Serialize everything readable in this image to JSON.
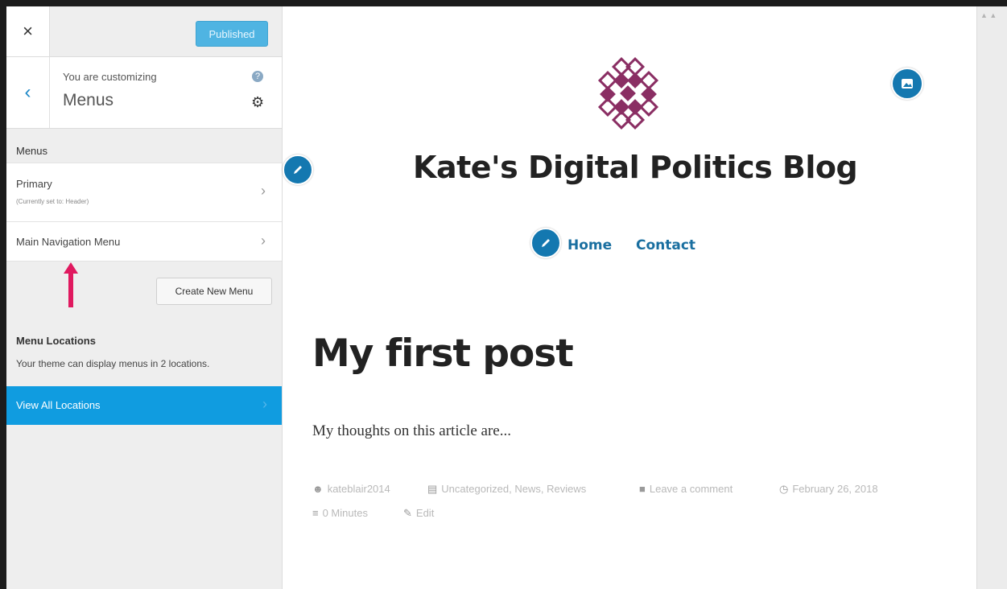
{
  "sidebar": {
    "close_glyph": "×",
    "publish_label": "Published",
    "customizing_label": "You are customizing",
    "panel_title": "Menus",
    "help_glyph": "?",
    "gear_glyph": "⚙",
    "back_glyph": "‹",
    "menus_heading": "Menus",
    "menus": [
      {
        "label": "Primary",
        "sub": "(Currently set to: Header)"
      },
      {
        "label": "Main Navigation Menu",
        "sub": ""
      }
    ],
    "chevron_glyph": "›",
    "create_menu_label": "Create New Menu",
    "locations_title": "Menu Locations",
    "locations_desc": "Your theme can display menus in 2 locations.",
    "view_all_label": "View All Locations",
    "arrow_color": "#e0195f",
    "accent_color": "#109ce0"
  },
  "preview": {
    "site_title": "Kate's Digital Politics Blog",
    "nav": [
      "Home",
      "Contact"
    ],
    "post_title": "My first post",
    "post_body": "My thoughts on this article are...",
    "meta": {
      "author": "kateblair2014",
      "categories": "Uncategorized, News, Reviews",
      "comments": "Leave a comment",
      "date": "February 26, 2018",
      "read_time": "0 Minutes",
      "edit": "Edit"
    },
    "logo_color": "#8a2e63",
    "edit_color": "#1478b0"
  }
}
